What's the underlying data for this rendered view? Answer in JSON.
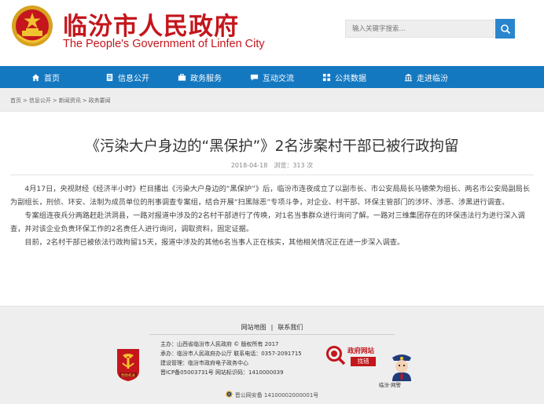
{
  "header": {
    "site_title": "临汾市人民政府",
    "site_subtitle": "The People's Government of Linfen City",
    "search_placeholder": "输入关键字搜索..."
  },
  "nav": {
    "items": [
      {
        "label": "首页",
        "icon": "home-icon"
      },
      {
        "label": "信息公开",
        "icon": "document-icon"
      },
      {
        "label": "政务服务",
        "icon": "briefcase-icon"
      },
      {
        "label": "互动交流",
        "icon": "chat-icon"
      },
      {
        "label": "公共数据",
        "icon": "data-icon"
      },
      {
        "label": "走进临汾",
        "icon": "landmark-icon"
      }
    ]
  },
  "breadcrumb": {
    "items": [
      "首页",
      "信息公开",
      "新闻资讯",
      "政务要闻"
    ],
    "separator": ">"
  },
  "article": {
    "title": "《污染大户身边的“黑保护”》2名涉案村干部已被行政拘留",
    "date": "2018-04-18",
    "views": "浏览：313 次",
    "paragraphs": [
      "4月17日，央视财经《经济半小时》栏目播出《污染大户身边的“黑保护”》后，临汾市连夜成立了以副市长、市公安局局长马德荣为组长、两名市公安局副局长为副组长，刑侦、环安、法制为成员单位的刑事调查专案组，结合开展“扫黑除恶”专项斗争，对企业、村干部、环保主管部门的涉环、涉恶、涉黑进行调查。",
      "专案组连夜兵分两路赶赴洪洞县，一路对报道中涉及的2名村干部进行了传唤，对1名当事群众进行询问了解。一路对三维集团存在的环保违法行为进行深入调查，并对该企业负责环保工作的2名责任人进行询问，调取资料，固定证据。",
      "目前，2名村干部已被依法行政拘留15天，报道中涉及的其他6名当事人正在核实，其他相关情况正在进一步深入调查。"
    ]
  },
  "footer": {
    "links": [
      "网站地图",
      "联系我们"
    ],
    "separator": "|",
    "info_lines": [
      "主办：山西省临汾市人民政府 © 版权所有 2017",
      "承办：临汾市人民政府办公厅 联系电话：0357-2091715",
      "建设管理：临汾市政府电子政务中心",
      "晋ICP备05003731号  网站标识码：1410000039"
    ],
    "dangjian_label": "党政机关",
    "wzzc_label": "政府网站",
    "wzzc_button": "找错",
    "police_label": "临汾·网警",
    "gongan": "晋公网安备 14100002000001号"
  },
  "colors": {
    "brand_red": "#c4161c",
    "nav_blue": "#1478c0",
    "search_blue": "#2a85cc"
  }
}
